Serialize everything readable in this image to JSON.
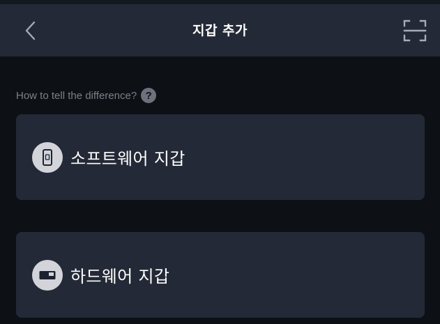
{
  "header": {
    "title": "지갑 추가",
    "back_icon": "chevron-left-icon",
    "scan_icon": "scan-frame-icon"
  },
  "hint": {
    "text": "How to tell the difference?",
    "help_symbol": "?"
  },
  "options": [
    {
      "label": "소프트웨어 지갑",
      "icon": "mobile-phone-icon"
    },
    {
      "label": "하드웨어 지갑",
      "icon": "hardware-device-icon"
    }
  ],
  "colors": {
    "background": "#0d1015",
    "surface": "#232936",
    "text": "#ffffff",
    "muted_text": "#7b808b",
    "icon_circle": "#d2d4d9"
  }
}
